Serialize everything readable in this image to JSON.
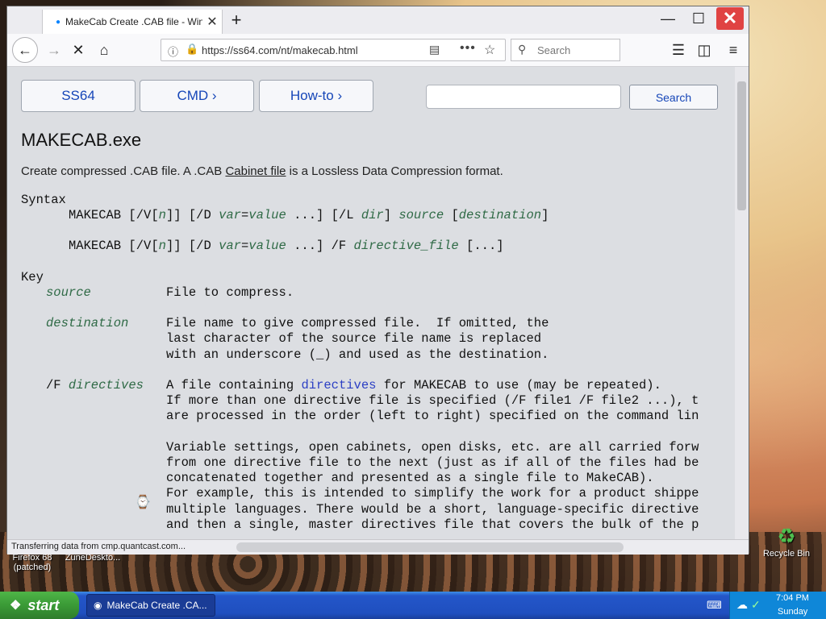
{
  "browser": {
    "tab_title": "MakeCab Create .CAB file - Windo",
    "url": "https://ss64.com/nt/makecab.html",
    "search_placeholder": "Search",
    "status_text": "Transferring data from cmp.quantcast.com..."
  },
  "page": {
    "nav": {
      "ss64": "SS64",
      "cmd": "CMD ›",
      "howto": "How-to ›"
    },
    "search_button": "Search",
    "heading": "MAKECAB.exe",
    "desc_pre": "Create compressed .CAB file. A .CAB ",
    "desc_link": "Cabinet file",
    "desc_post": " is a Lossless Data Compression format.",
    "syntax_label": "Syntax",
    "syntax_line1": {
      "a": "MAKECAB [/V[",
      "n": "n",
      "b": "]] [/D ",
      "var": "var",
      "eq": "=",
      "value": "value",
      "c": " ...] [/L ",
      "dir": "dir",
      "d": "] ",
      "source": "source",
      "e": " [",
      "destination": "destination",
      "f": "]"
    },
    "syntax_line2": {
      "a": "MAKECAB [/V[",
      "n": "n",
      "b": "]] [/D ",
      "var": "var",
      "eq": "=",
      "value": "value",
      "c": " ...] /F ",
      "dfile": "directive_file",
      "d": " [...]"
    },
    "key_label": "Key",
    "key_source": "source",
    "key_source_desc": "File to compress.",
    "key_dest": "destination",
    "key_dest_desc": [
      "File name to give compressed file.  If omitted, the",
      "last character of the source file name is replaced",
      "with an underscore (_) and used as the destination."
    ],
    "key_f_prefix": "/F ",
    "key_f": "directives",
    "key_f_line1_pre": "A file containing ",
    "key_f_line1_link": "directives",
    "key_f_line1_post": " for MAKECAB to use (may be repeated).",
    "key_f_desc": [
      "If more than one directive file is specified (/F file1 /F file2 ...), t",
      "are processed in the order (left to right) specified on the command lin"
    ],
    "key_f_desc2": [
      "Variable settings, open cabinets, open disks, etc. are all carried forw",
      "from one directive file to the next (just as if all of the files had be",
      "concatenated together and presented as a single file to MakeCAB).",
      "For example, this is intended to simplify the work for a product shippe",
      "multiple languages. There would be a short, language-specific directive",
      "and then a single, master directives file that covers the bulk of the p"
    ]
  },
  "desktop": {
    "icon1": "Firefox 68",
    "icon1b": "(patched)",
    "icon2": "ZuneDeskto...",
    "recycle": "Recycle Bin"
  },
  "taskbar": {
    "start": "start",
    "task_item": "MakeCab Create .CA...",
    "time": "7:04 PM",
    "day": "Sunday"
  }
}
